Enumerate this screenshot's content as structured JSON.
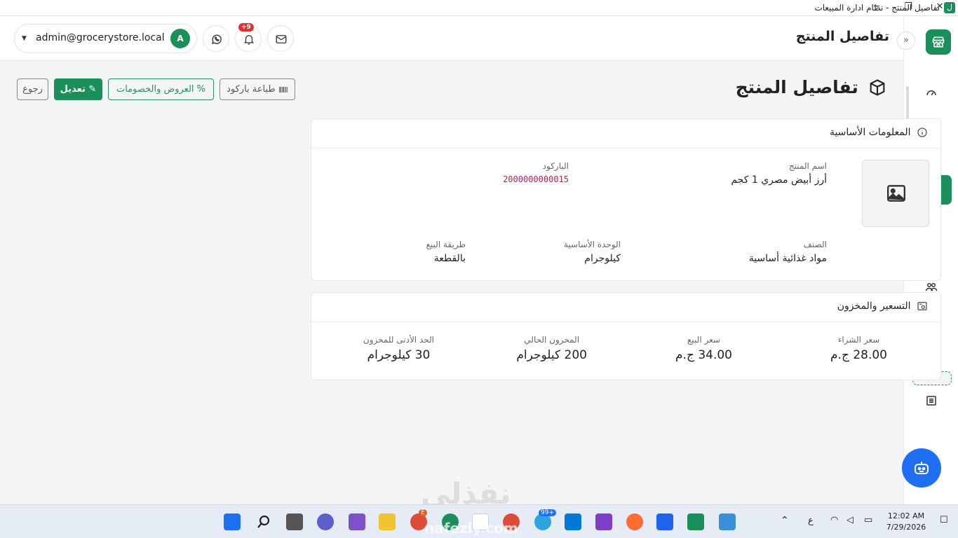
{
  "window": {
    "title": "تفاصيل المنتج - نظام ادارة المبيعات",
    "app_icon": "ل",
    "controls": {
      "minimize": "─",
      "restore": "❐",
      "close": "✕"
    }
  },
  "header": {
    "title": "تفاصيل المنتج",
    "user_email": "admin@grocerystore.local",
    "user_initial": "A",
    "notifications_count": "+9",
    "icons": [
      "whatsapp-icon",
      "bell-icon",
      "mail-icon"
    ]
  },
  "sidebar": {
    "collapse": "»",
    "items": [
      "dashboard-icon",
      "tag-icon",
      "ruler-icon",
      "box-icon",
      "percent-icon",
      "truck-icon",
      "users-icon",
      "cart-icon",
      "return-icon",
      "blank",
      "report-icon"
    ]
  },
  "page": {
    "title": "تفاصيل المنتج",
    "buttons": {
      "back": "رجوع",
      "edit": "تعديل",
      "offers": "% العروض والخصومات",
      "print_barcode": "طباعة باركود"
    }
  },
  "basic_info": {
    "heading": "المعلومات الأساسية",
    "name_label": "اسم المنتج",
    "name_value": "أرز أبيض مصري 1 كجم",
    "barcode_label": "الباركود",
    "barcode_value": "2000000000015",
    "category_label": "الصنف",
    "category_value": "مواد غذائية أساسية",
    "unit_label": "الوحدة الأساسية",
    "unit_value": "كيلوجرام",
    "sale_method_label": "طريقة البيع",
    "sale_method_value": "بالقطعة"
  },
  "pricing": {
    "heading": "التسعير والمخزون",
    "purchase_label": "سعر الشراء",
    "purchase_value": "28.00 ج.م",
    "sale_label": "سعر البيع",
    "sale_value": "34.00 ج.م",
    "stock_label": "المخزون الحالي",
    "stock_value": "200 كيلوجرام",
    "min_stock_label": "الحد الأدنى للمخزون",
    "min_stock_value": "30 كيلوجرام"
  },
  "taskbar": {
    "lang": "ع",
    "time": "12:02 AM",
    "date": "7/29/2026",
    "telegram_badge": "99+",
    "chrome_badge": "E"
  },
  "watermark": {
    "text": "نفذلي",
    "url": "nafezly.com"
  },
  "colors": {
    "accent": "#1a8f5a",
    "bot": "#1e6ff2",
    "barcode": "#c2185b"
  }
}
